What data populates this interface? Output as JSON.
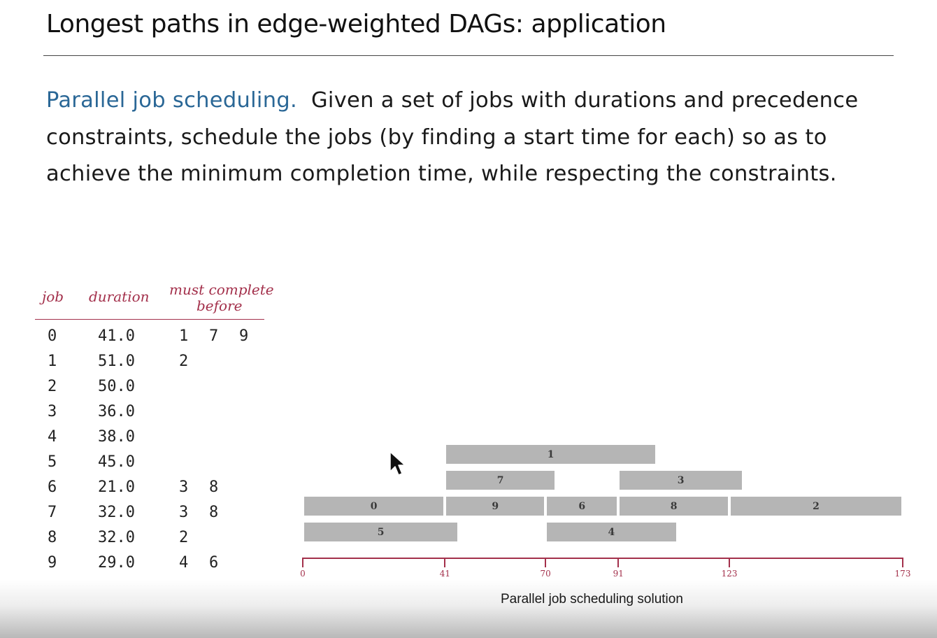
{
  "slide": {
    "title": "Longest paths in edge-weighted DAGs:  application",
    "intro_term": "Parallel job scheduling.",
    "intro_body": "Given a set of jobs with durations and precedence constraints, schedule the jobs (by finding a start time for each) so as to achieve the minimum completion time, while respecting the constraints."
  },
  "table": {
    "headers": {
      "job": "job",
      "duration": "duration",
      "must_line1": "must complete",
      "must_line2": "before"
    },
    "rows": [
      {
        "job": "0",
        "duration": "41.0",
        "before": [
          "1",
          "7",
          "9"
        ]
      },
      {
        "job": "1",
        "duration": "51.0",
        "before": [
          "2"
        ]
      },
      {
        "job": "2",
        "duration": "50.0",
        "before": []
      },
      {
        "job": "3",
        "duration": "36.0",
        "before": []
      },
      {
        "job": "4",
        "duration": "38.0",
        "before": []
      },
      {
        "job": "5",
        "duration": "45.0",
        "before": []
      },
      {
        "job": "6",
        "duration": "21.0",
        "before": [
          "3",
          "8"
        ]
      },
      {
        "job": "7",
        "duration": "32.0",
        "before": [
          "3",
          "8"
        ]
      },
      {
        "job": "8",
        "duration": "32.0",
        "before": [
          "2"
        ]
      },
      {
        "job": "9",
        "duration": "29.0",
        "before": [
          "4",
          "6"
        ]
      }
    ]
  },
  "chart_data": {
    "type": "gantt",
    "title": "Parallel job scheduling solution",
    "xlim": [
      0,
      173
    ],
    "ticks": [
      0,
      41,
      70,
      91,
      123,
      173
    ],
    "tick_labels": [
      "0",
      "41",
      "70",
      "91",
      "123",
      "173"
    ],
    "jobs": [
      {
        "label": "1",
        "start": 41,
        "end": 102
      },
      {
        "label": "7",
        "start": 41,
        "end": 73
      },
      {
        "label": "3",
        "start": 91,
        "end": 127
      },
      {
        "label": "0",
        "start": 0,
        "end": 41
      },
      {
        "label": "9",
        "start": 41,
        "end": 70
      },
      {
        "label": "6",
        "start": 70,
        "end": 91
      },
      {
        "label": "8",
        "start": 91,
        "end": 123
      },
      {
        "label": "2",
        "start": 123,
        "end": 173
      },
      {
        "label": "5",
        "start": 0,
        "end": 45
      },
      {
        "label": "4",
        "start": 70,
        "end": 108
      }
    ],
    "bar_color": "#b5b5b5",
    "axis_color": "#a3304b"
  }
}
